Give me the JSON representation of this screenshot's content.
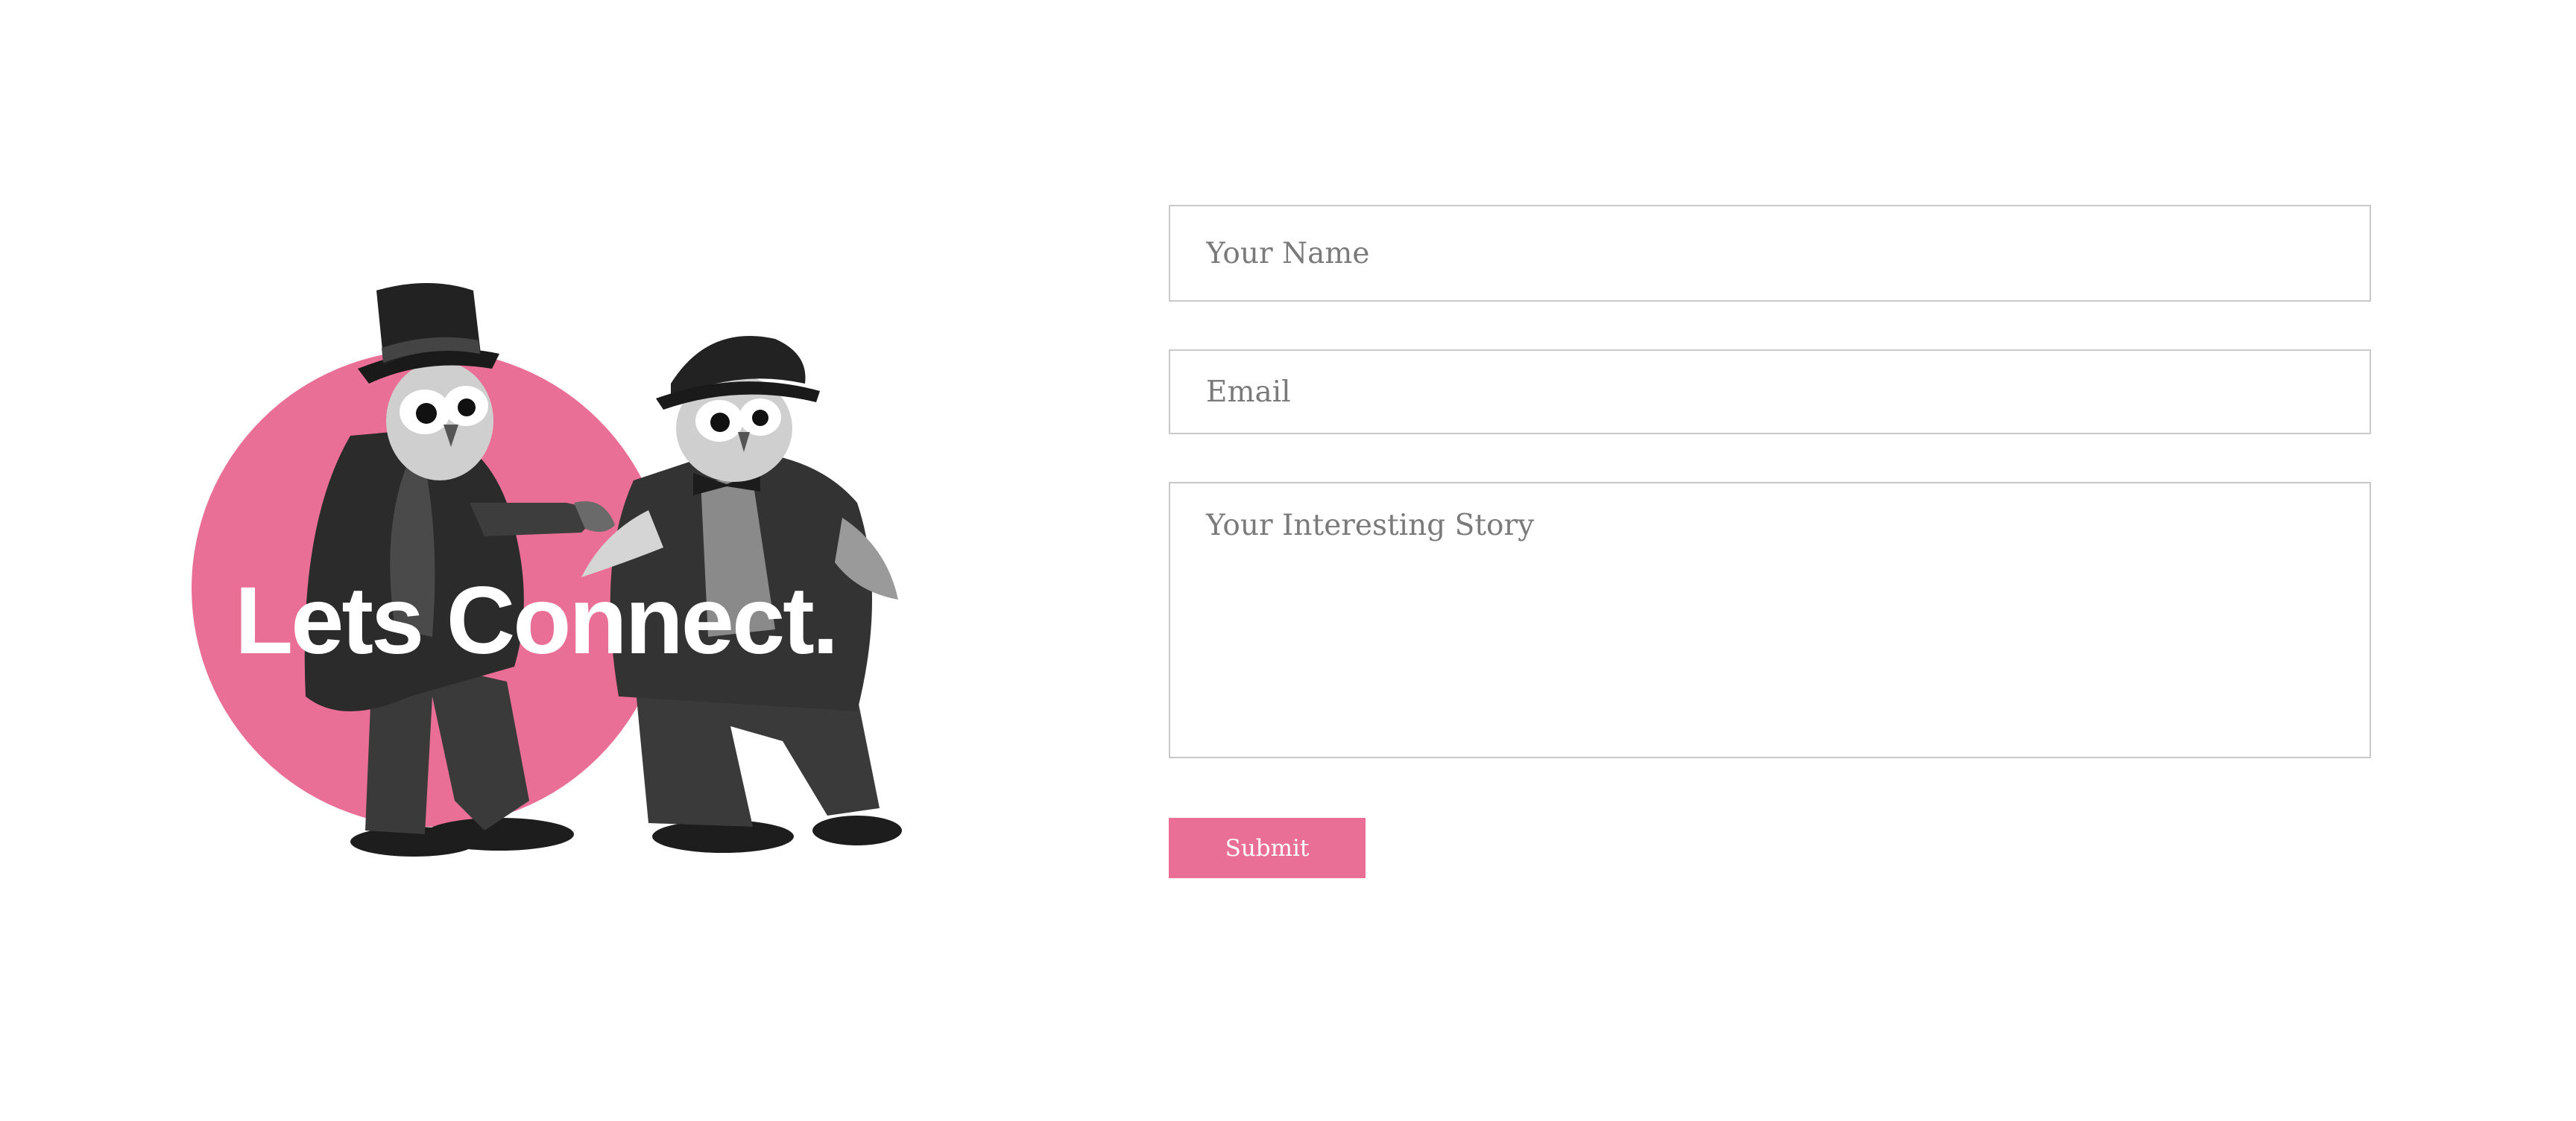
{
  "colors": {
    "accent": "#EA6F96",
    "background": "#FFFFFF",
    "field_border": "#C9C9C9",
    "placeholder": "#7A7A7A",
    "owl_dark": "#2B2B2B"
  },
  "hero": {
    "title": "Lets Connect.",
    "image": "dancing-owls-illustration"
  },
  "form": {
    "name_placeholder": "Your Name",
    "email_placeholder": "Email",
    "story_placeholder": "Your Interesting Story",
    "submit_label": "Submit"
  }
}
